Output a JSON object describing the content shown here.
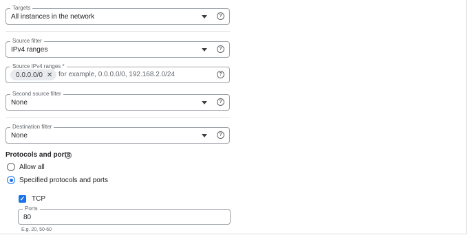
{
  "targets": {
    "label": "Targets",
    "value": "All instances in the network"
  },
  "source_filter": {
    "label": "Source filter",
    "value": "IPv4 ranges"
  },
  "source_ranges": {
    "label": "Source IPv4 ranges *",
    "chip": "0.0.0.0/0",
    "placeholder": "for example, 0.0.0.0/0, 192.168.2.0/24"
  },
  "second_source_filter": {
    "label": "Second source filter",
    "value": "None"
  },
  "destination_filter": {
    "label": "Destination filter",
    "value": "None"
  },
  "protocols": {
    "title": "Protocols and ports",
    "options": [
      {
        "label": "Allow all",
        "selected": false
      },
      {
        "label": "Specified protocols and ports",
        "selected": true
      }
    ],
    "tcp": {
      "label": "TCP",
      "checked": true
    },
    "ports": {
      "label": "Ports",
      "value": "80",
      "hint": "E.g. 20, 50-60"
    }
  },
  "icons": {
    "dropdown": "chevron-down-icon",
    "help": "help-circle-icon",
    "remove": "close-icon",
    "check": "checkmark-icon"
  },
  "colors": {
    "accent": "#1a73e8",
    "border": "#9aa0a6",
    "text": "#202124",
    "muted": "#5f6368"
  }
}
